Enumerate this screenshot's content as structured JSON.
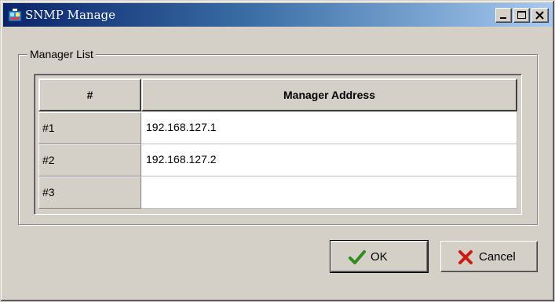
{
  "window": {
    "title": "SNMP Manage",
    "icon": "snmp-app-icon",
    "controls": [
      "minimize-icon",
      "maximize-icon",
      "close-icon"
    ]
  },
  "group": {
    "label": "Manager List"
  },
  "table": {
    "headers": [
      "#",
      "Manager Address"
    ],
    "rows": [
      {
        "index": "#1",
        "address": "192.168.127.1"
      },
      {
        "index": "#2",
        "address": "192.168.127.2"
      },
      {
        "index": "#3",
        "address": ""
      }
    ]
  },
  "buttons": {
    "ok": {
      "label": "OK",
      "icon": "checkmark-icon",
      "color": "#2e8b1e"
    },
    "cancel": {
      "label": "Cancel",
      "icon": "x-icon",
      "color": "#cc1a10"
    }
  }
}
